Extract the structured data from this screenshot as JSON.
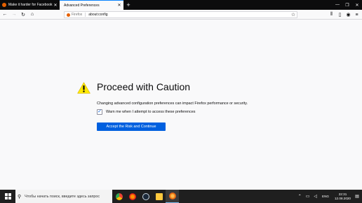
{
  "tabs": [
    {
      "label": "Make it harder for Facebook to",
      "active": false
    },
    {
      "label": "Advanced Preferences",
      "active": true
    }
  ],
  "window_controls": [
    "minimize",
    "maximize",
    "close"
  ],
  "navbar": {
    "identity_label": "Firefox",
    "url": "about:config"
  },
  "page": {
    "heading": "Proceed with Caution",
    "description": "Changing advanced configuration preferences can impact Firefox performance or security.",
    "checkbox_label": "Warn me when I attempt to access these preferences",
    "checkbox_checked": true,
    "accept_button": "Accept the Risk and Continue"
  },
  "taskbar": {
    "search_placeholder": "Чтобы начать поиск, введите здесь запрос",
    "apps": [
      "chrome-icon",
      "firefox-dev-icon",
      "steam-icon",
      "file-explorer-icon",
      "firefox-icon"
    ],
    "language": "ENG",
    "time": "22:31",
    "date": "12.08.2020"
  },
  "colors": {
    "accent": "#0060df",
    "warning": "#ffe900",
    "tabstrip": "#0c0c0d"
  }
}
